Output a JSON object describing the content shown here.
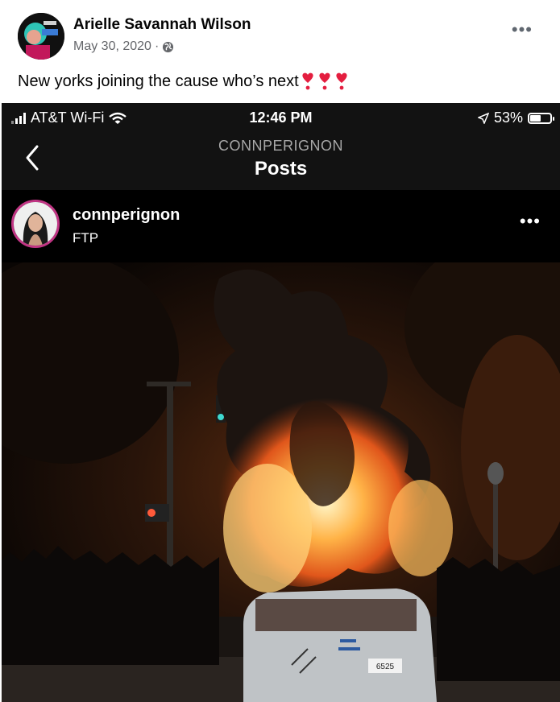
{
  "post": {
    "author": "Arielle Savannah Wilson",
    "date": "May 30, 2020",
    "separator": "·",
    "privacy_icon": "globe-icon",
    "more_icon": "more-horizontal-icon",
    "caption": "New yorks joining the cause who’s next",
    "caption_emoji": "heart-exclamation-icon"
  },
  "screenshot": {
    "status_bar": {
      "carrier": "AT&T Wi-Fi",
      "time": "12:46 PM",
      "battery": "53%",
      "battery_level": 0.53
    },
    "nav": {
      "subtitle": "CONNPERIGNON",
      "title": "Posts",
      "back_icon": "chevron-left-icon"
    },
    "ig_post": {
      "username": "connperignon",
      "location": "FTP",
      "more_icon": "more-horizontal-icon"
    }
  },
  "colors": {
    "heart": "#e41e3f",
    "fire": "#ff8a1e",
    "meta_gray": "#65676b"
  }
}
